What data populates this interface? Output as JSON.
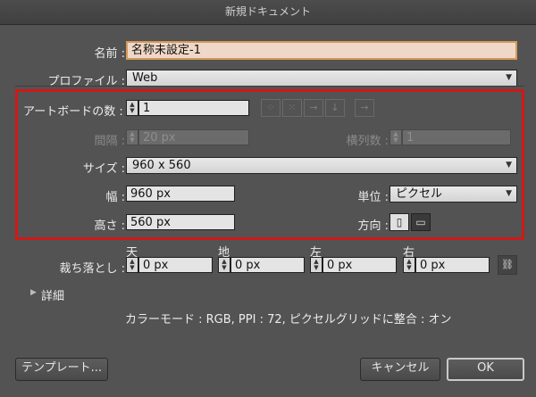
{
  "window": {
    "title": "新規ドキュメント"
  },
  "name": {
    "label": "名前 :",
    "value": "名称未設定-1"
  },
  "profile": {
    "label": "プロファイル :",
    "value": "Web"
  },
  "artboards": {
    "count_label": "アートボードの数 :",
    "count_value": "1",
    "spacing_label": "間隔 :",
    "spacing_value": "20 px",
    "columns_label": "横列数 :",
    "columns_value": "1",
    "layout_icons": [
      "grid-by-row-icon",
      "grid-by-column-icon",
      "arrange-by-row-icon",
      "arrange-by-column-icon",
      "right-to-left-icon"
    ]
  },
  "size": {
    "label": "サイズ :",
    "value": "960 x 560"
  },
  "width": {
    "label": "幅 :",
    "value": "960 px"
  },
  "height": {
    "label": "高さ :",
    "value": "560 px"
  },
  "units": {
    "label": "単位 :",
    "value": "ピクセル"
  },
  "orientation": {
    "label": "方向 :",
    "icons": [
      "portrait-icon",
      "landscape-icon"
    ],
    "selected": "landscape"
  },
  "bleed": {
    "label": "裁ち落とし :",
    "top": {
      "label": "天",
      "value": "0 px"
    },
    "bottom": {
      "label": "地",
      "value": "0 px"
    },
    "left": {
      "label": "左",
      "value": "0 px"
    },
    "right": {
      "label": "右",
      "value": "0 px"
    },
    "link_icon": "chain-link-icon"
  },
  "advanced": {
    "label": "詳細"
  },
  "summary": "カラーモード : RGB, PPI : 72, ピクセルグリッドに整合 : オン",
  "buttons": {
    "templates": "テンプレート...",
    "cancel": "キャンセル",
    "ok": "OK"
  }
}
